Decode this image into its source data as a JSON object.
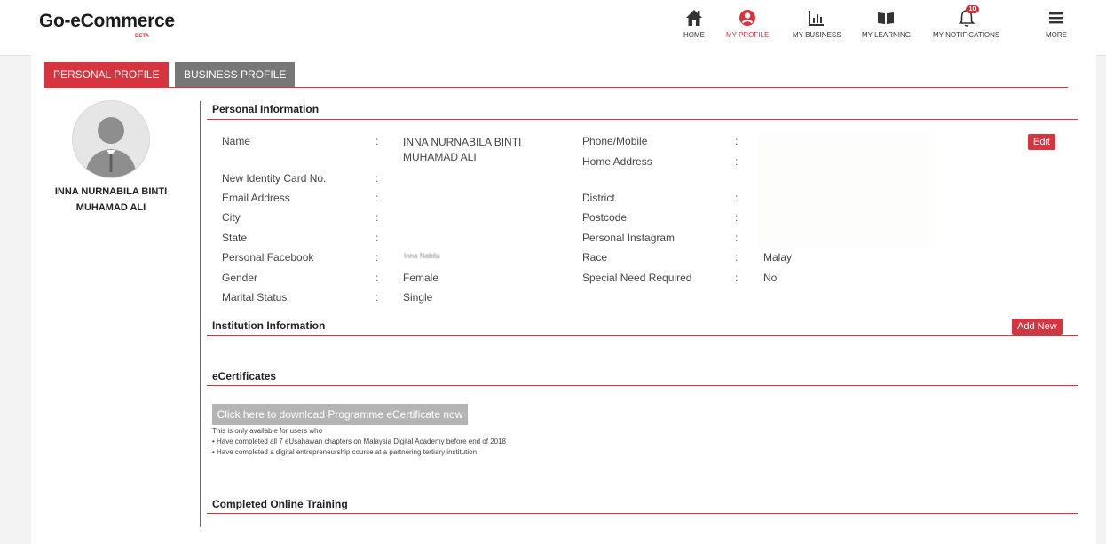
{
  "header": {
    "logo": "Go-eCommerce",
    "beta": "BETA",
    "nav": [
      {
        "label": "HOME",
        "icon": "home-icon"
      },
      {
        "label": "MY PROFILE",
        "icon": "profile-icon"
      },
      {
        "label": "MY BUSINESS",
        "icon": "chart-icon"
      },
      {
        "label": "MY LEARNING",
        "icon": "book-icon"
      },
      {
        "label": "MY NOTIFICATIONS",
        "icon": "bell-icon",
        "badge": "10"
      },
      {
        "label": "MORE",
        "icon": "menu-icon"
      }
    ]
  },
  "tabs": {
    "personal": "PERSONAL PROFILE",
    "business": "BUSINESS PROFILE"
  },
  "profile": {
    "name": "INNA NURNABILA BINTI MUHAMAD ALI"
  },
  "personal_info": {
    "title": "Personal Information",
    "edit_label": "Edit",
    "colon": ":",
    "left_fields": [
      {
        "label": "Name",
        "value": "INNA NURNABILA BINTI MUHAMAD ALI"
      },
      {
        "label": "New Identity Card No.",
        "value": ""
      },
      {
        "label": "Email Address",
        "value": ""
      },
      {
        "label": "City",
        "value": ""
      },
      {
        "label": "State",
        "value": ""
      },
      {
        "label": "Personal Facebook",
        "value": "Inna Nabila"
      },
      {
        "label": "Gender",
        "value": "Female"
      },
      {
        "label": "Marital Status",
        "value": "Single"
      }
    ],
    "right_fields": [
      {
        "label": "Phone/Mobile",
        "value": ""
      },
      {
        "label": "Home Address",
        "value": ""
      },
      {
        "label": "District",
        "value": ""
      },
      {
        "label": "Postcode",
        "value": ""
      },
      {
        "label": "Personal Instagram",
        "value": ""
      },
      {
        "label": "Race",
        "value": "Malay"
      },
      {
        "label": "Special Need Required",
        "value": "No"
      }
    ]
  },
  "institution": {
    "title": "Institution Information",
    "add_label": "Add New"
  },
  "ecert": {
    "title": "eCertificates",
    "button": "Click here to download Programme eCertificate now",
    "note": "This is only available for users who",
    "bullets": [
      "Have completed all 7 eUsahawan chapters on Malaysia Digital Academy before end of 2018",
      "Have completed a digital entrepreneurship course at a partnering tertiary institution"
    ]
  },
  "training": {
    "title": "Completed Online Training"
  },
  "colors": {
    "accent": "#d6343e",
    "tab_inactive": "#777777"
  }
}
